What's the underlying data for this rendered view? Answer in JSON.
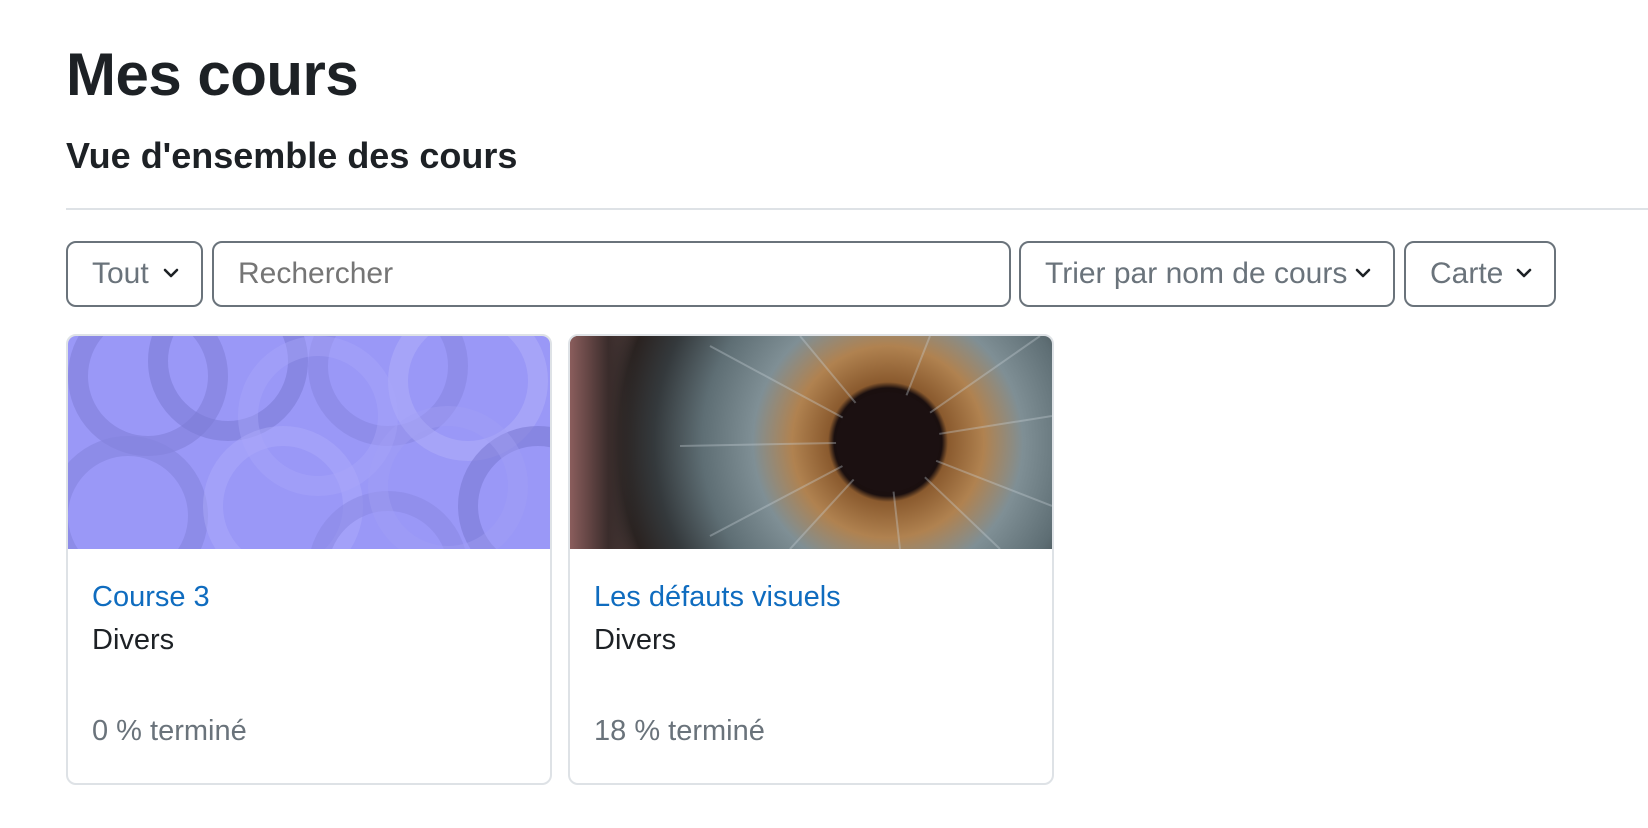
{
  "page": {
    "title": "Mes cours",
    "section_title": "Vue d'ensemble des cours"
  },
  "filters": {
    "grouping": {
      "selected": "Tout",
      "icon": "chevron-down-icon"
    },
    "search": {
      "placeholder": "Rechercher",
      "value": ""
    },
    "sort": {
      "selected": "Trier par nom de cours",
      "icon": "chevron-down-icon"
    },
    "view": {
      "selected": "Carte",
      "icon": "chevron-down-icon"
    }
  },
  "courses": [
    {
      "name": "Course 3",
      "category": "Divers",
      "progress_text": "0 % terminé",
      "progress_percent": 0,
      "image": "generated-pattern-image",
      "image_color": "#9a98f7"
    },
    {
      "name": "Les défauts visuels",
      "category": "Divers",
      "progress_text": "18 % terminé",
      "progress_percent": 18,
      "image": "eye-iris-photo"
    }
  ],
  "colors": {
    "link": "#0f6cbf",
    "text": "#1d2125",
    "muted": "#6a737b",
    "border": "#dee2e6"
  }
}
